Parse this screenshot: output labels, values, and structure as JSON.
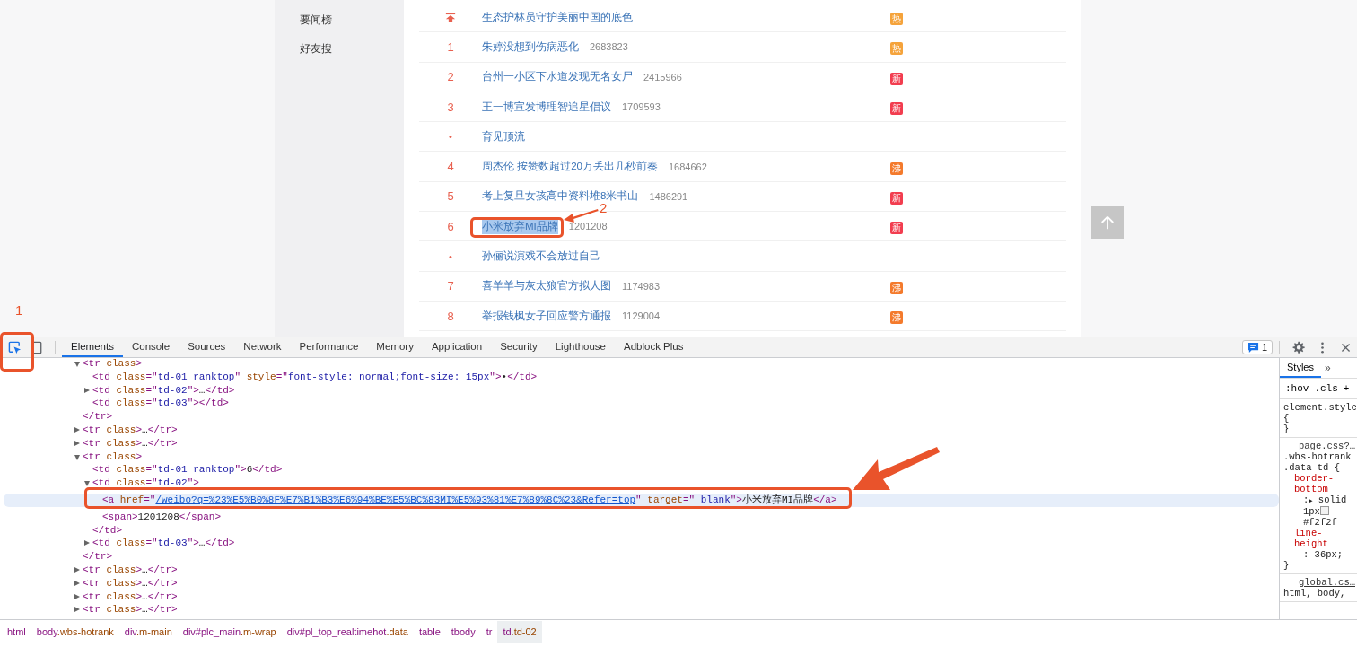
{
  "sidebar": {
    "items": [
      {
        "label": "要闻榜",
        "selected": false
      },
      {
        "label": "好友搜",
        "selected": false
      }
    ]
  },
  "hotlist": {
    "rows": [
      {
        "kind": "pinned",
        "title": "生态护林员守护美丽中国的底色",
        "highlighted": false,
        "badge": {
          "text": "热",
          "color": "#f5a33b"
        }
      },
      {
        "kind": "ranked",
        "rank": "1",
        "title": "朱婷没想到伤病恶化",
        "count": "2683823",
        "highlighted": false,
        "badge": {
          "text": "热",
          "color": "#f5a33b"
        }
      },
      {
        "kind": "ranked",
        "rank": "2",
        "title": "台州一小区下水道发现无名女尸",
        "count": "2415966",
        "highlighted": false,
        "badge": {
          "text": "新",
          "color": "#f23d4f"
        }
      },
      {
        "kind": "ranked",
        "rank": "3",
        "title": "王一博宣发博理智追星倡议",
        "count": "1709593",
        "highlighted": false,
        "badge": {
          "text": "新",
          "color": "#f23d4f"
        }
      },
      {
        "kind": "promoted",
        "rank": "•",
        "title": "育见顶流",
        "highlighted": false
      },
      {
        "kind": "ranked",
        "rank": "4",
        "title": "周杰伦 按赞数超过20万丢出几秒前奏",
        "count": "1684662",
        "highlighted": false,
        "badge": {
          "text": "沸",
          "color": "#f47a2c"
        }
      },
      {
        "kind": "ranked",
        "rank": "5",
        "title": "考上复旦女孩高中资料堆8米书山",
        "count": "1486291",
        "highlighted": false,
        "badge": {
          "text": "新",
          "color": "#f23d4f"
        }
      },
      {
        "kind": "ranked",
        "rank": "6",
        "title": "小米放弃MI品牌",
        "count": "1201208",
        "highlighted": true,
        "badge": {
          "text": "新",
          "color": "#f23d4f"
        }
      },
      {
        "kind": "promoted",
        "rank": "•",
        "title": "孙俪说演戏不会放过自己",
        "highlighted": false
      },
      {
        "kind": "ranked",
        "rank": "7",
        "title": "喜羊羊与灰太狼官方拟人图",
        "count": "1174983",
        "highlighted": false,
        "badge": {
          "text": "沸",
          "color": "#f47a2c"
        }
      },
      {
        "kind": "ranked",
        "rank": "8",
        "title": "举报钱枫女子回应警方通报",
        "count": "1129004",
        "highlighted": false,
        "badge": {
          "text": "沸",
          "color": "#f47a2c"
        }
      }
    ]
  },
  "devtools": {
    "tools": [
      {
        "kind": "inspect",
        "selected": true
      },
      {
        "kind": "device",
        "selected": false
      }
    ],
    "tabs": [
      {
        "label": "Elements",
        "selected": true
      },
      {
        "label": "Console",
        "selected": false
      },
      {
        "label": "Sources",
        "selected": false
      },
      {
        "label": "Network",
        "selected": false
      },
      {
        "label": "Performance",
        "selected": false
      },
      {
        "label": "Memory",
        "selected": false
      },
      {
        "label": "Application",
        "selected": false
      },
      {
        "label": "Security",
        "selected": false
      },
      {
        "label": "Lighthouse",
        "selected": false
      },
      {
        "label": "Adblock Plus",
        "selected": false
      }
    ],
    "issues": "1",
    "elements": [
      {
        "expanded": true,
        "selected": false,
        "open": [
          {
            "kind": "tag",
            "text": "<tr "
          },
          {
            "kind": "attr",
            "text": "class"
          },
          {
            "kind": "tag",
            "text": ">"
          }
        ],
        "children": [
          {
            "selected": false,
            "open": [
              {
                "kind": "tag",
                "text": "<td "
              },
              {
                "kind": "attr",
                "text": "class"
              },
              {
                "kind": "tag",
                "text": "=\""
              },
              {
                "kind": "value",
                "text": "td-01 ranktop"
              },
              {
                "kind": "tag",
                "text": "\" "
              },
              {
                "kind": "attr",
                "text": "style"
              },
              {
                "kind": "tag",
                "text": "=\""
              },
              {
                "kind": "value",
                "text": "font-style: normal;font-size: 15px"
              },
              {
                "kind": "tag",
                "text": "\">"
              },
              {
                "kind": "text",
                "text": "•"
              },
              {
                "kind": "tag",
                "text": "</td>"
              }
            ]
          },
          {
            "expanded": false,
            "selected": false,
            "open": [
              {
                "kind": "tag",
                "text": "<td "
              },
              {
                "kind": "attr",
                "text": "class"
              },
              {
                "kind": "tag",
                "text": "=\""
              },
              {
                "kind": "value",
                "text": "td-02"
              },
              {
                "kind": "tag",
                "text": "\">"
              },
              {
                "kind": "text",
                "text": "…"
              },
              {
                "kind": "tag",
                "text": "</td>"
              }
            ]
          },
          {
            "selected": false,
            "open": [
              {
                "kind": "tag",
                "text": "<td "
              },
              {
                "kind": "attr",
                "text": "class"
              },
              {
                "kind": "tag",
                "text": "=\""
              },
              {
                "kind": "value",
                "text": "td-03"
              },
              {
                "kind": "tag",
                "text": "\"></td>"
              }
            ]
          }
        ],
        "close": [
          {
            "kind": "tag",
            "text": "</tr>"
          }
        ]
      },
      {
        "expanded": false,
        "selected": false,
        "open": [
          {
            "kind": "tag",
            "text": "<tr "
          },
          {
            "kind": "attr",
            "text": "class"
          },
          {
            "kind": "tag",
            "text": ">"
          },
          {
            "kind": "text",
            "text": "…"
          },
          {
            "kind": "tag",
            "text": "</tr>"
          }
        ]
      },
      {
        "expanded": false,
        "selected": false,
        "open": [
          {
            "kind": "tag",
            "text": "<tr "
          },
          {
            "kind": "attr",
            "text": "class"
          },
          {
            "kind": "tag",
            "text": ">"
          },
          {
            "kind": "text",
            "text": "…"
          },
          {
            "kind": "tag",
            "text": "</tr>"
          }
        ]
      },
      {
        "expanded": true,
        "selected": false,
        "open": [
          {
            "kind": "tag",
            "text": "<tr "
          },
          {
            "kind": "attr",
            "text": "class"
          },
          {
            "kind": "tag",
            "text": ">"
          }
        ],
        "children": [
          {
            "selected": false,
            "open": [
              {
                "kind": "tag",
                "text": "<td "
              },
              {
                "kind": "attr",
                "text": "class"
              },
              {
                "kind": "tag",
                "text": "=\""
              },
              {
                "kind": "value",
                "text": "td-01 ranktop"
              },
              {
                "kind": "tag",
                "text": "\">"
              },
              {
                "kind": "text",
                "text": "6"
              },
              {
                "kind": "tag",
                "text": "</td>"
              }
            ]
          },
          {
            "expanded": true,
            "selected": false,
            "open": [
              {
                "kind": "tag",
                "text": "<td "
              },
              {
                "kind": "attr",
                "text": "class"
              },
              {
                "kind": "tag",
                "text": "=\""
              },
              {
                "kind": "value",
                "text": "td-02"
              },
              {
                "kind": "tag",
                "text": "\">"
              }
            ],
            "children": [
              {
                "selected": true,
                "open": [
                  {
                    "kind": "tag",
                    "text": "<a "
                  },
                  {
                    "kind": "attr",
                    "text": "href"
                  },
                  {
                    "kind": "tag",
                    "text": "=\""
                  },
                  {
                    "kind": "link",
                    "text": "/weibo?q=%23%E5%B0%8F%E7%B1%B3%E6%94%BE%E5%BC%83MI%E5%93%81%E7%89%8C%23&Refer=top"
                  },
                  {
                    "kind": "tag",
                    "text": "\" "
                  },
                  {
                    "kind": "attr",
                    "text": "target"
                  },
                  {
                    "kind": "tag",
                    "text": "=\""
                  },
                  {
                    "kind": "value",
                    "text": "_blank"
                  },
                  {
                    "kind": "tag",
                    "text": "\">"
                  },
                  {
                    "kind": "text",
                    "text": "小米放弃MI品牌"
                  },
                  {
                    "kind": "tag",
                    "text": "</a>"
                  }
                ]
              },
              {
                "selected": false,
                "open": [
                  {
                    "kind": "tag",
                    "text": "<span>"
                  },
                  {
                    "kind": "text",
                    "text": "1201208"
                  },
                  {
                    "kind": "tag",
                    "text": "</span>"
                  }
                ]
              }
            ],
            "close": [
              {
                "kind": "tag",
                "text": "</td>"
              }
            ]
          },
          {
            "expanded": false,
            "selected": false,
            "open": [
              {
                "kind": "tag",
                "text": "<td "
              },
              {
                "kind": "attr",
                "text": "class"
              },
              {
                "kind": "tag",
                "text": "=\""
              },
              {
                "kind": "value",
                "text": "td-03"
              },
              {
                "kind": "tag",
                "text": "\">"
              },
              {
                "kind": "text",
                "text": "…"
              },
              {
                "kind": "tag",
                "text": "</td>"
              }
            ]
          }
        ],
        "close": [
          {
            "kind": "tag",
            "text": "</tr>"
          }
        ]
      },
      {
        "expanded": false,
        "selected": false,
        "open": [
          {
            "kind": "tag",
            "text": "<tr "
          },
          {
            "kind": "attr",
            "text": "class"
          },
          {
            "kind": "tag",
            "text": ">"
          },
          {
            "kind": "text",
            "text": "…"
          },
          {
            "kind": "tag",
            "text": "</tr>"
          }
        ]
      },
      {
        "expanded": false,
        "selected": false,
        "open": [
          {
            "kind": "tag",
            "text": "<tr "
          },
          {
            "kind": "attr",
            "text": "class"
          },
          {
            "kind": "tag",
            "text": ">"
          },
          {
            "kind": "text",
            "text": "…"
          },
          {
            "kind": "tag",
            "text": "</tr>"
          }
        ]
      },
      {
        "expanded": false,
        "selected": false,
        "open": [
          {
            "kind": "tag",
            "text": "<tr "
          },
          {
            "kind": "attr",
            "text": "class"
          },
          {
            "kind": "tag",
            "text": ">"
          },
          {
            "kind": "text",
            "text": "…"
          },
          {
            "kind": "tag",
            "text": "</tr>"
          }
        ]
      },
      {
        "expanded": false,
        "selected": false,
        "open": [
          {
            "kind": "tag",
            "text": "<tr "
          },
          {
            "kind": "attr",
            "text": "class"
          },
          {
            "kind": "tag",
            "text": ">"
          },
          {
            "kind": "text",
            "text": "…"
          },
          {
            "kind": "tag",
            "text": "</tr>"
          }
        ]
      }
    ],
    "styles": {
      "tab": "Styles",
      "more": "»",
      "filters": [
        ":hov",
        ".cls",
        "+"
      ],
      "rules": [
        {
          "selector": "element.style {",
          "close": "}"
        },
        {
          "source": "page.css?…",
          "selector": ".wbs-hotrank .data td {",
          "props": [
            {
              "name": "border-bottom",
              "sep": ":",
              "toggle": "▶",
              "value": "solid 1px",
              "swatch": true,
              "color_text": "#f2f2f"
            },
            {
              "name": "line-height",
              "sep": ":",
              "value": "36px;"
            }
          ],
          "close": "}"
        },
        {
          "source": "global.cs…",
          "selector": "html, body,"
        }
      ]
    },
    "breadcrumbs": [
      {
        "tag": "html",
        "selected": false
      },
      {
        "tag": "body",
        "rest": ".wbs-hotrank",
        "selected": false
      },
      {
        "tag": "div",
        "rest": ".m-main",
        "selected": false
      },
      {
        "tag": "div#plc_main",
        "rest": ".m-wrap",
        "selected": false
      },
      {
        "tag": "div#pl_top_realtimehot",
        "rest": ".data",
        "selected": false
      },
      {
        "tag": "table",
        "selected": false
      },
      {
        "tag": "tbody",
        "selected": false
      },
      {
        "tag": "tr",
        "selected": false
      },
      {
        "tag": "td",
        "rest": ".td-02",
        "selected": true
      }
    ]
  },
  "annotations": [
    {
      "kind": "box",
      "label": "1"
    },
    {
      "kind": "arrow",
      "label": "2"
    },
    {
      "kind": "arrow"
    }
  ]
}
